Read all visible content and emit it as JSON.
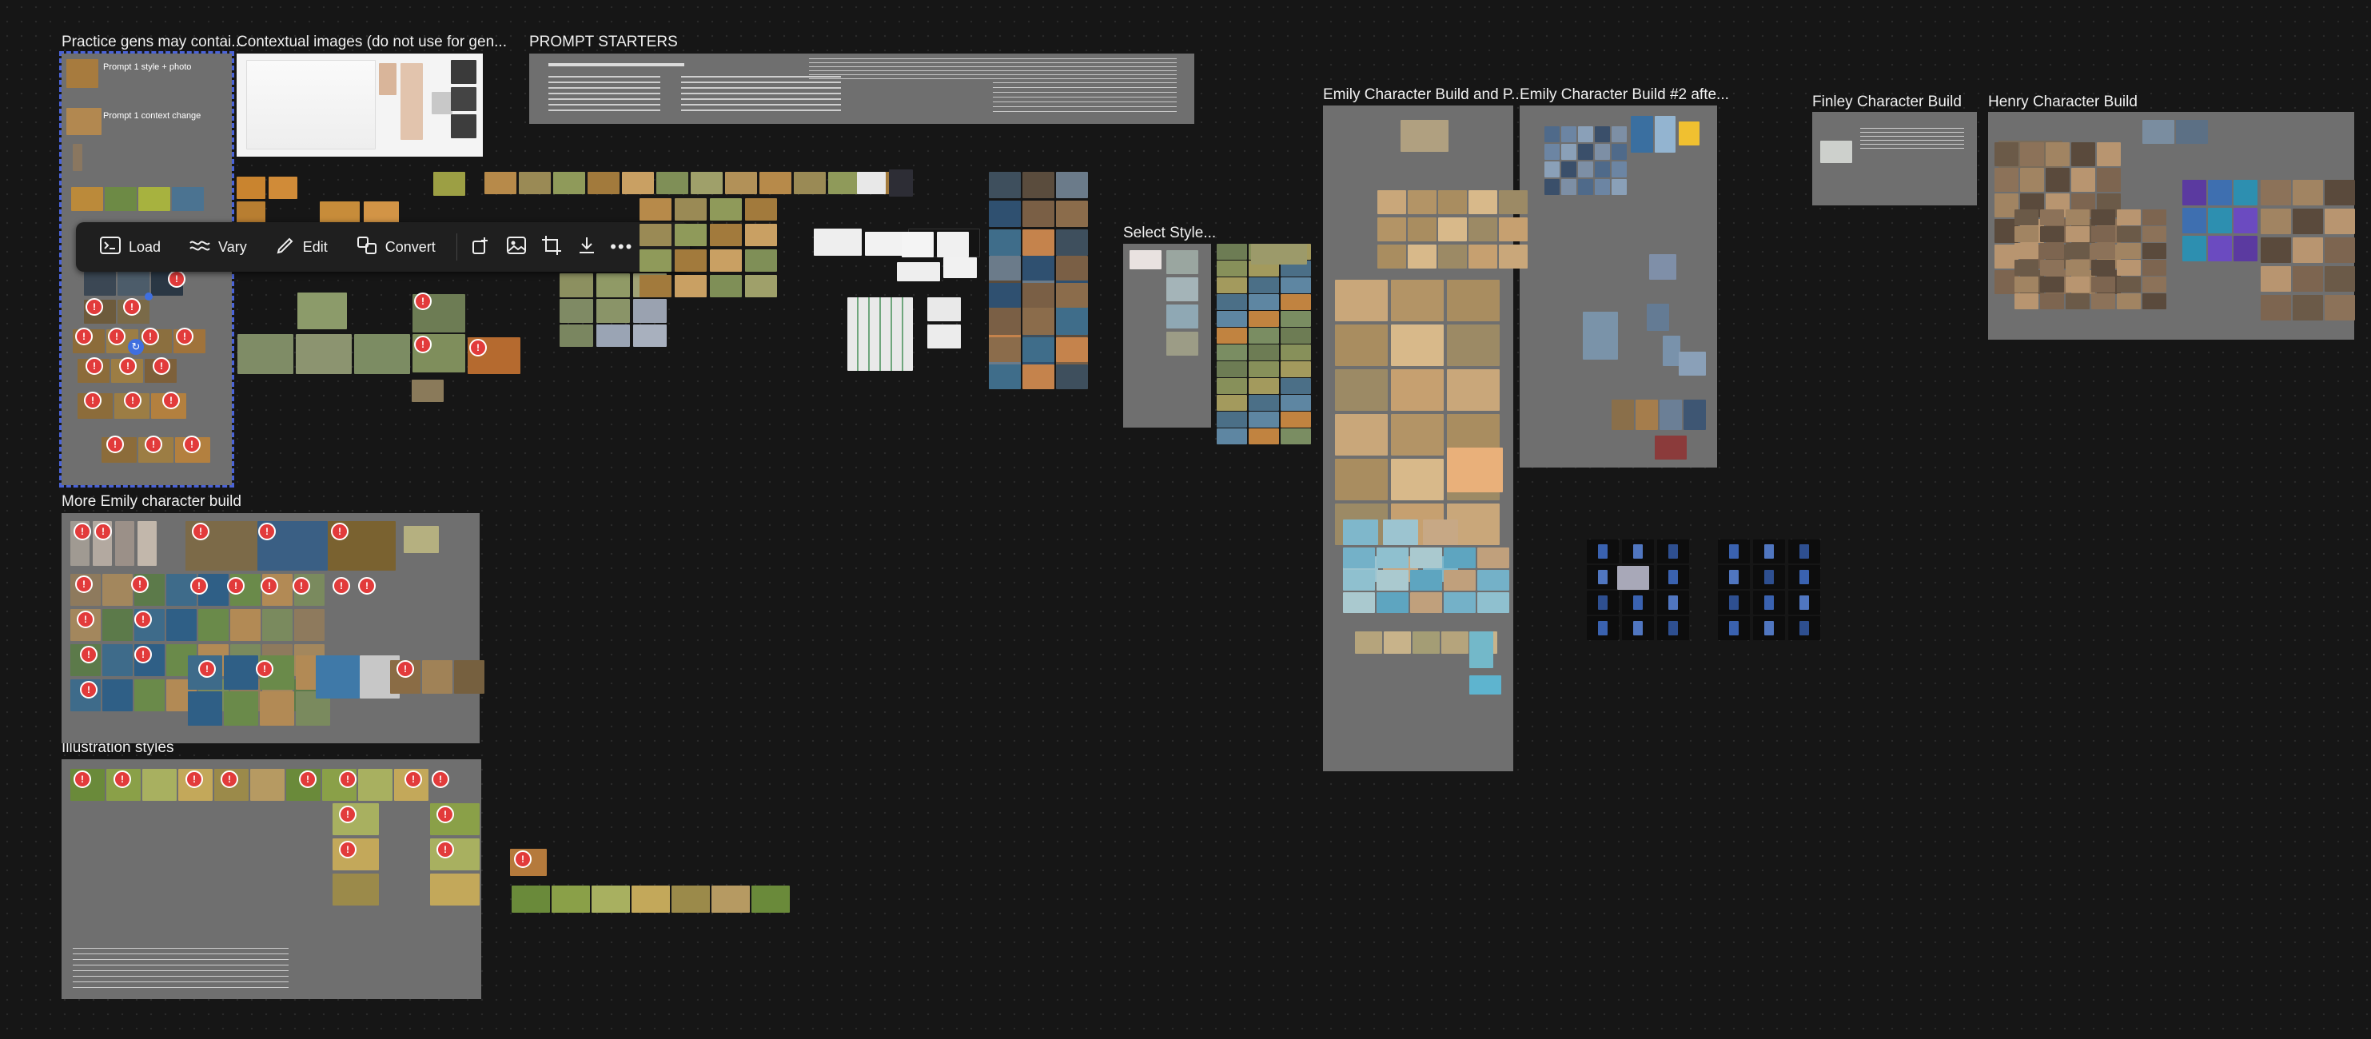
{
  "boards": {
    "practice": {
      "title": "Practice gens may contai...",
      "prompt_style_photo": "Prompt 1 style + photo",
      "prompt_context_change": "Prompt 1 context change"
    },
    "contextual": {
      "title": "Contextual images (do not use for gen..."
    },
    "prompt_starters": {
      "title": "PROMPT STARTERS"
    },
    "select_style": {
      "title": "Select Style..."
    },
    "emily_build": {
      "title": "Emily Character Build and P..."
    },
    "emily_build_2": {
      "title": "Emily Character Build #2 afte..."
    },
    "finley": {
      "title": "Finley Character Build"
    },
    "henry": {
      "title": "Henry Character Build"
    },
    "more_emily": {
      "title": "More Emily character build"
    },
    "illustration": {
      "title": "Illustration styles"
    }
  },
  "toolbar": {
    "load": "Load",
    "vary": "Vary",
    "edit": "Edit",
    "convert": "Convert"
  },
  "icons": {
    "load": "terminal-icon",
    "vary": "wave-icon",
    "edit": "pencil-icon",
    "convert": "convert-icon",
    "upscale": "upscale-icon",
    "image": "image-icon",
    "crop": "crop-icon",
    "download": "download-icon",
    "more": "more-icon",
    "warning": "warning-icon"
  },
  "colors": {
    "canvas": "#161616",
    "board": "#6f6f6f",
    "selection": "#4a63d8",
    "warning": "#e23b3b"
  }
}
